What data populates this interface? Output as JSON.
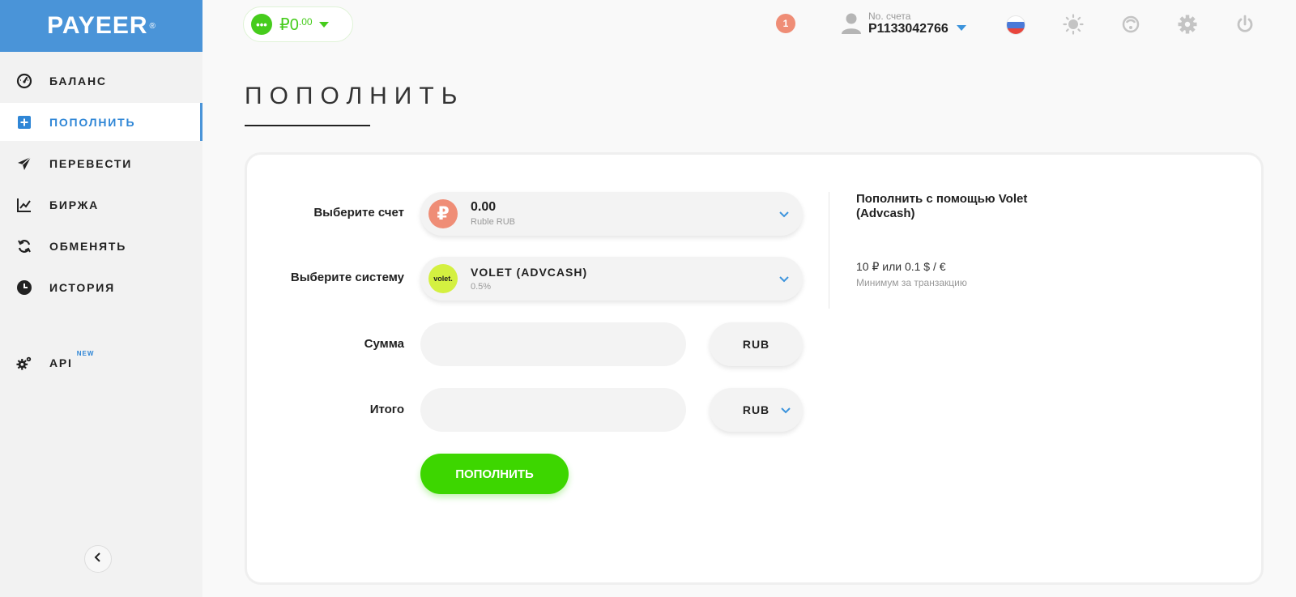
{
  "brand": {
    "logo_text": "PAYEER",
    "trademark": "®"
  },
  "sidebar": {
    "items": [
      {
        "label": "БАЛАНС",
        "icon": "speedometer-icon"
      },
      {
        "label": "ПОПОЛНИТЬ",
        "icon": "plus-square-icon",
        "active": true
      },
      {
        "label": "ПЕРЕВЕСТИ",
        "icon": "paper-plane-icon"
      },
      {
        "label": "БИРЖА",
        "icon": "chart-icon"
      },
      {
        "label": "ОБМЕНЯТЬ",
        "icon": "exchange-icon"
      },
      {
        "label": "ИСТОРИЯ",
        "icon": "clock-icon"
      }
    ],
    "api": {
      "label": "API",
      "badge": "NEW",
      "icon": "gears-icon"
    },
    "collapse_icon": "chevron-left-icon"
  },
  "header": {
    "balance": {
      "currency_symbol": "₽",
      "integer": "0",
      "decimals": ".00"
    },
    "notifications": {
      "count": "1"
    },
    "account": {
      "label": "No. счета",
      "number": "P1133042766"
    },
    "icons": [
      "flag-ru-icon",
      "sun-icon",
      "support-icon",
      "gear-icon",
      "power-icon"
    ],
    "colors": {
      "accent": "#4a94d8",
      "green": "#46cc1c",
      "notify": "#ef8d76"
    }
  },
  "page": {
    "title": "ПОПОЛНИТЬ"
  },
  "form": {
    "account": {
      "label": "Выберите счет",
      "value": "0.00",
      "sub": "Ruble RUB",
      "coin_symbol": "₽",
      "coin_color": "#ef8d76"
    },
    "system": {
      "label": "Выберите систему",
      "value": "VOLET (ADVCASH)",
      "sub": "0.5%",
      "logo_text": "volet.",
      "logo_color": "#d4f040"
    },
    "amount": {
      "label": "Сумма",
      "value": "",
      "placeholder": "",
      "currency": "RUB"
    },
    "total": {
      "label": "Итого",
      "value": "",
      "placeholder": "",
      "currency": "RUB"
    },
    "submit_label": "ПОПОЛНИТЬ"
  },
  "info": {
    "title": "Пополнить с помощью Volet (Advcash)",
    "min_value": "10 ₽ или 0.1 $ / €",
    "min_label": "Минимум за транзакцию"
  }
}
